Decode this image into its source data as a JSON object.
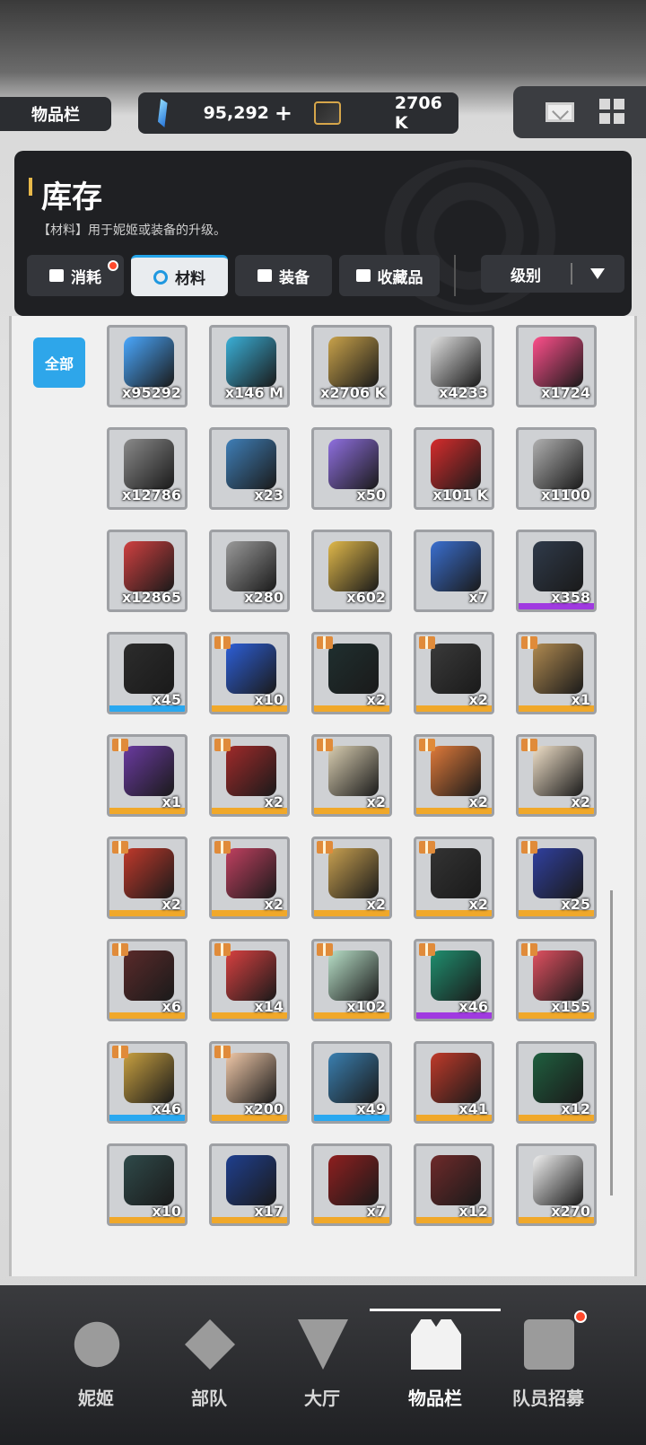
{
  "header": {
    "title": "物品栏",
    "currency1": "95,292",
    "currency1_plus": "+",
    "currency2": "2706 K",
    "mail_icon": "mail-icon",
    "menu_icon": "grid-icon"
  },
  "panel": {
    "title": "库存",
    "description": "【材料】用于妮姬或装备的升级。",
    "tabs": [
      {
        "label": "消耗",
        "has_badge": true
      },
      {
        "label": "材料",
        "active": true
      },
      {
        "label": "装备"
      },
      {
        "label": "收藏品"
      }
    ],
    "sort_label": "级别"
  },
  "filter_all": "全部",
  "items": [
    {
      "qty": "x95292",
      "color": "#4aa8ff",
      "rarity": ""
    },
    {
      "qty": "x146 M",
      "color": "#3ab0d8",
      "rarity": ""
    },
    {
      "qty": "x2706 K",
      "color": "#c9a24a",
      "rarity": ""
    },
    {
      "qty": "x4233",
      "color": "#e0e0e0",
      "rarity": ""
    },
    {
      "qty": "x1724",
      "color": "#ff4f8b",
      "rarity": ""
    },
    {
      "qty": "x12786",
      "color": "#8a8a8a",
      "rarity": ""
    },
    {
      "qty": "x23",
      "color": "#3f7fb8",
      "rarity": ""
    },
    {
      "qty": "x50",
      "color": "#8f6fe0",
      "rarity": ""
    },
    {
      "qty": "x101 K",
      "color": "#d62c2c",
      "rarity": ""
    },
    {
      "qty": "x1100",
      "color": "#b0b0b0",
      "rarity": ""
    },
    {
      "qty": "x12865",
      "color": "#d04040",
      "rarity": ""
    },
    {
      "qty": "x280",
      "color": "#9a9a9a",
      "rarity": ""
    },
    {
      "qty": "x602",
      "color": "#e0b84a",
      "rarity": ""
    },
    {
      "qty": "x7",
      "color": "#3a6fd0",
      "rarity": ""
    },
    {
      "qty": "x358",
      "color": "#2f3a4a",
      "rarity": "#a03ae0"
    },
    {
      "qty": "x45",
      "color": "#2c2c2c",
      "rarity": "#2aa8f0"
    },
    {
      "qty": "x10",
      "color": "#2d5fd8",
      "rarity": "#f0a82a",
      "gift": true
    },
    {
      "qty": "x2",
      "color": "#1f2f2f",
      "rarity": "#f0a82a",
      "gift": true
    },
    {
      "qty": "x2",
      "color": "#3a3a3a",
      "rarity": "#f0a82a",
      "gift": true
    },
    {
      "qty": "x1",
      "color": "#b08a50",
      "rarity": "#f0a82a",
      "gift": true
    },
    {
      "qty": "x1",
      "color": "#6a3aa0",
      "rarity": "#f0a82a",
      "gift": true
    },
    {
      "qty": "x2",
      "color": "#a02a2a",
      "rarity": "#f0a82a",
      "gift": true
    },
    {
      "qty": "x2",
      "color": "#d8cdb0",
      "rarity": "#f0a82a",
      "gift": true
    },
    {
      "qty": "x2",
      "color": "#e07a3a",
      "rarity": "#f0a82a",
      "gift": true
    },
    {
      "qty": "x2",
      "color": "#f0e0c8",
      "rarity": "#f0a82a",
      "gift": true
    },
    {
      "qty": "x2",
      "color": "#c0392b",
      "rarity": "#f0a82a",
      "gift": true
    },
    {
      "qty": "x2",
      "color": "#c04060",
      "rarity": "#f0a82a",
      "gift": true
    },
    {
      "qty": "x2",
      "color": "#c8a050",
      "rarity": "#f0a82a",
      "gift": true
    },
    {
      "qty": "x2",
      "color": "#333333",
      "rarity": "#f0a82a",
      "gift": true
    },
    {
      "qty": "x25",
      "color": "#3040a0",
      "rarity": "#f0a82a",
      "gift": true
    },
    {
      "qty": "x6",
      "color": "#5a2a2a",
      "rarity": "#f0a82a",
      "gift": true
    },
    {
      "qty": "x14",
      "color": "#d84040",
      "rarity": "#f0a82a",
      "gift": true
    },
    {
      "qty": "x102",
      "color": "#b8e0c8",
      "rarity": "#f0a82a",
      "gift": true
    },
    {
      "qty": "x46",
      "color": "#1f8f6f",
      "rarity": "#a03ae0",
      "gift": true
    },
    {
      "qty": "x155",
      "color": "#e05060",
      "rarity": "#f0a82a",
      "gift": true
    },
    {
      "qty": "x46",
      "color": "#c8a040",
      "rarity": "#2aa8f0",
      "gift": true
    },
    {
      "qty": "x200",
      "color": "#f0c8a8",
      "rarity": "#f0a82a",
      "gift": true
    },
    {
      "qty": "x49",
      "color": "#3a7fb0",
      "rarity": "#2aa8f0"
    },
    {
      "qty": "x41",
      "color": "#c03a2a",
      "rarity": "#f0a82a"
    },
    {
      "qty": "x12",
      "color": "#1f5f3f",
      "rarity": "#f0a82a"
    },
    {
      "qty": "x10",
      "color": "#2f4a4a",
      "rarity": "#f0a82a"
    },
    {
      "qty": "x17",
      "color": "#1f3f8f",
      "rarity": "#f0a82a"
    },
    {
      "qty": "x7",
      "color": "#8f1f1f",
      "rarity": "#f0a82a"
    },
    {
      "qty": "x12",
      "color": "#6f2a2a",
      "rarity": "#f0a82a"
    },
    {
      "qty": "x270",
      "color": "#f0f0f0",
      "rarity": "#f0a82a"
    }
  ],
  "bottom_nav": [
    {
      "label": "妮姬",
      "icon": "people-icon"
    },
    {
      "label": "部队",
      "icon": "squad-icon"
    },
    {
      "label": "大厅",
      "icon": "lobby-icon"
    },
    {
      "label": "物品栏",
      "icon": "vest-icon",
      "active": true
    },
    {
      "label": "队员招募",
      "icon": "clipboard-icon",
      "has_badge": true
    }
  ]
}
